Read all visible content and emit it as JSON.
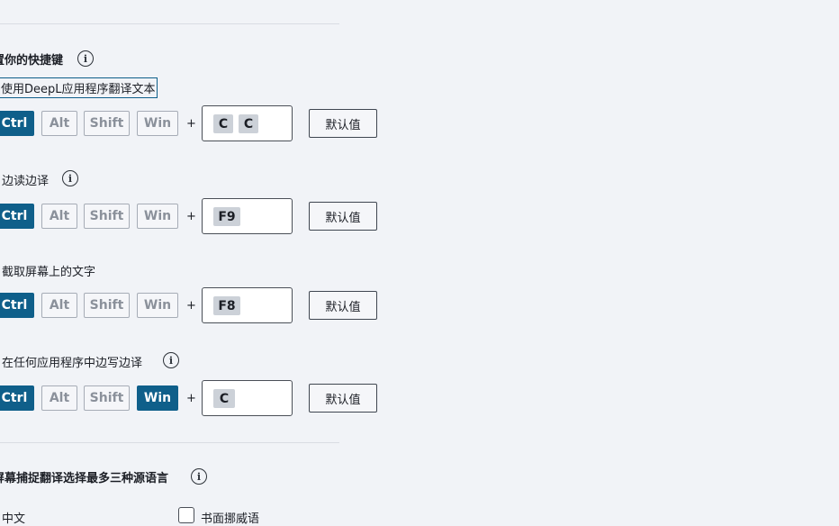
{
  "shortcuts_section": {
    "title": "置你的快捷键"
  },
  "shortcuts": [
    {
      "label": "使用DeepL应用程序翻译文本",
      "info": false,
      "modifiers": {
        "ctrl": true,
        "alt": false,
        "shift": false,
        "win": false
      },
      "keys": [
        "C",
        "C"
      ],
      "default_label": "默认值"
    },
    {
      "label": "边读边译",
      "info": true,
      "modifiers": {
        "ctrl": true,
        "alt": false,
        "shift": false,
        "win": false
      },
      "keys": [
        "F9"
      ],
      "default_label": "默认值"
    },
    {
      "label": "截取屏幕上的文字",
      "info": false,
      "modifiers": {
        "ctrl": true,
        "alt": false,
        "shift": false,
        "win": false
      },
      "keys": [
        "F8"
      ],
      "default_label": "默认值"
    },
    {
      "label": "在任何应用程序中边写边译",
      "info": true,
      "modifiers": {
        "ctrl": true,
        "alt": false,
        "shift": false,
        "win": true
      },
      "keys": [
        "C"
      ],
      "default_label": "默认值"
    }
  ],
  "modifier_labels": {
    "ctrl": "Ctrl",
    "alt": "Alt",
    "shift": "Shift",
    "win": "Win",
    "plus": "+"
  },
  "capture_section": {
    "title": "屏幕捕捉翻译选择最多三种源语言"
  },
  "languages": [
    {
      "label": "中文",
      "checked": true
    },
    {
      "label": "书面挪威语",
      "checked": false
    }
  ]
}
